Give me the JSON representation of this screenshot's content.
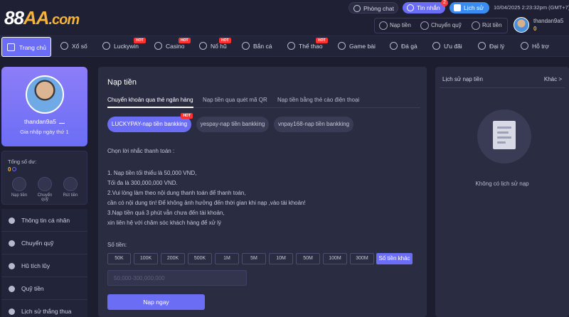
{
  "header": {
    "logo_main": "88",
    "logo_dots": "AA",
    "logo_com": ".com",
    "chat_label": "Phòng chat",
    "messages_label": "Tin nhắn",
    "messages_badge": "2",
    "history_label": "Lịch sử",
    "datetime": "10/04/2025 2:23:32pm (GMT+7)",
    "deposit_label": "Nạp tiền",
    "transfer_label": "Chuyển quỹ",
    "withdraw_label": "Rút tiền",
    "username": "thandan9a5",
    "balance": "0"
  },
  "nav": {
    "items": [
      {
        "label": "Trang chủ",
        "hot": false
      },
      {
        "label": "Xổ số",
        "hot": false
      },
      {
        "label": "Luckywin",
        "hot": true
      },
      {
        "label": "Casino",
        "hot": true
      },
      {
        "label": "Nổ hũ",
        "hot": true
      },
      {
        "label": "Bắn cá",
        "hot": false
      },
      {
        "label": "Thể thao",
        "hot": true
      },
      {
        "label": "Game bài",
        "hot": false
      },
      {
        "label": "Đá gà",
        "hot": false
      },
      {
        "label": "Ưu đãi",
        "hot": false
      },
      {
        "label": "Đại lý",
        "hot": false
      },
      {
        "label": "Hỗ trợ",
        "hot": false
      }
    ],
    "hot_label": "HOT"
  },
  "sidebar": {
    "username": "thandan9a5",
    "join_text": "Gia nhập ngày thứ 1",
    "wallet_title": "Tổng số dư:",
    "wallet_amount": "0",
    "wallet_buttons": [
      "Nạp tiền",
      "Chuyển quỹ",
      "Rút tiền"
    ],
    "menu": [
      "Thông tin cá nhân",
      "Chuyển quỹ",
      "Hũ tích lũy",
      "Quỹ tiền",
      "Lịch sử thắng thua"
    ]
  },
  "main": {
    "title": "Nạp tiền",
    "tabs": [
      "Chuyển khoản qua thẻ ngân hàng",
      "Nạp tiền qua quét mã QR",
      "Nạp tiền bằng thẻ cào điện thoại"
    ],
    "channels": [
      "LUCKYPAY-nạp tiền bankking",
      "yespay-nạp tiền bankking",
      "vnpay168-nạp tiền bankking"
    ],
    "prompt": "Chọn lời nhắc thanh toán :",
    "notes": [
      "1. Nạp tiền tối thiểu là 50,000 VND,",
      "Tối đa là 300,000,000 VND.",
      "2.Vui lòng làm theo nội dung thanh toán để thanh toán,",
      "cần có nội dung tin! Để không ảnh hưởng đến thời gian khi nạp ,vào tài khoản!",
      "3.Nạp tiền quá 3 phút vẫn chưa đến tài khoản,",
      "xin liên hệ với chăm sóc khách hàng để xử lý"
    ],
    "amount_label": "Số tiền:",
    "amounts": [
      "50K",
      "100K",
      "200K",
      "500K",
      "1M",
      "5M",
      "10M",
      "50M",
      "100M",
      "300M"
    ],
    "other_amount": "Số tiền khác",
    "amount_placeholder": "50,000-300,000,000",
    "submit": "Nạp ngay"
  },
  "history": {
    "title": "Lịch sử nạp tiền",
    "more": "Khác >",
    "empty": "Không có lịch sử nạp"
  }
}
